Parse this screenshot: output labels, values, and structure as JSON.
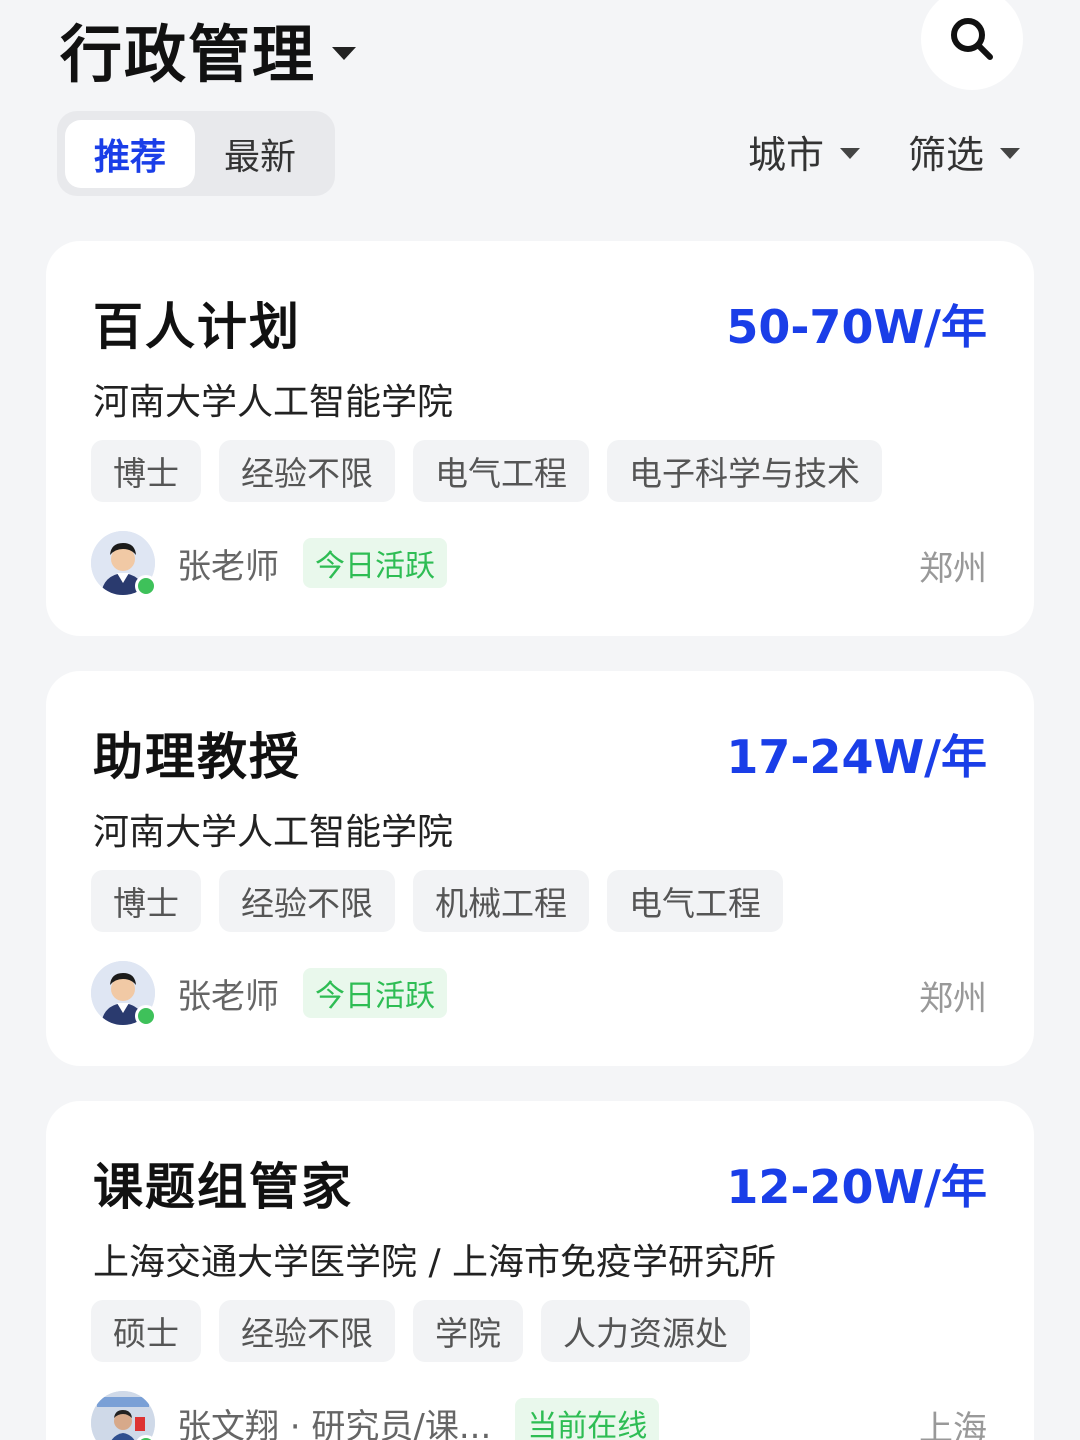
{
  "header": {
    "title": "行政管理",
    "search_icon": "search-icon"
  },
  "tabs": [
    {
      "label": "推荐",
      "active": true
    },
    {
      "label": "最新",
      "active": false
    }
  ],
  "filters": {
    "city_label": "城市",
    "filter_label": "筛选"
  },
  "colors": {
    "accent": "#1a3ee8",
    "active_green": "#2ebd54",
    "background": "#f4f5f7"
  },
  "jobs": [
    {
      "title": "百人计划",
      "salary": "50-70W/年",
      "org": "河南大学人工智能学院",
      "tags": [
        "博士",
        "经验不限",
        "电气工程",
        "电子科学与技术"
      ],
      "recruiter": "张老师",
      "status": "今日活跃",
      "city": "郑州"
    },
    {
      "title": "助理教授",
      "salary": "17-24W/年",
      "org": "河南大学人工智能学院",
      "tags": [
        "博士",
        "经验不限",
        "机械工程",
        "电气工程"
      ],
      "recruiter": "张老师",
      "status": "今日活跃",
      "city": "郑州"
    },
    {
      "title": "课题组管家",
      "salary": "12-20W/年",
      "org": "上海交通大学医学院 / 上海市免疫学研究所",
      "tags": [
        "硕士",
        "经验不限",
        "学院",
        "人力资源处"
      ],
      "recruiter": "张文翔 · 研究员/课...",
      "status": "当前在线",
      "city": "上海"
    }
  ]
}
